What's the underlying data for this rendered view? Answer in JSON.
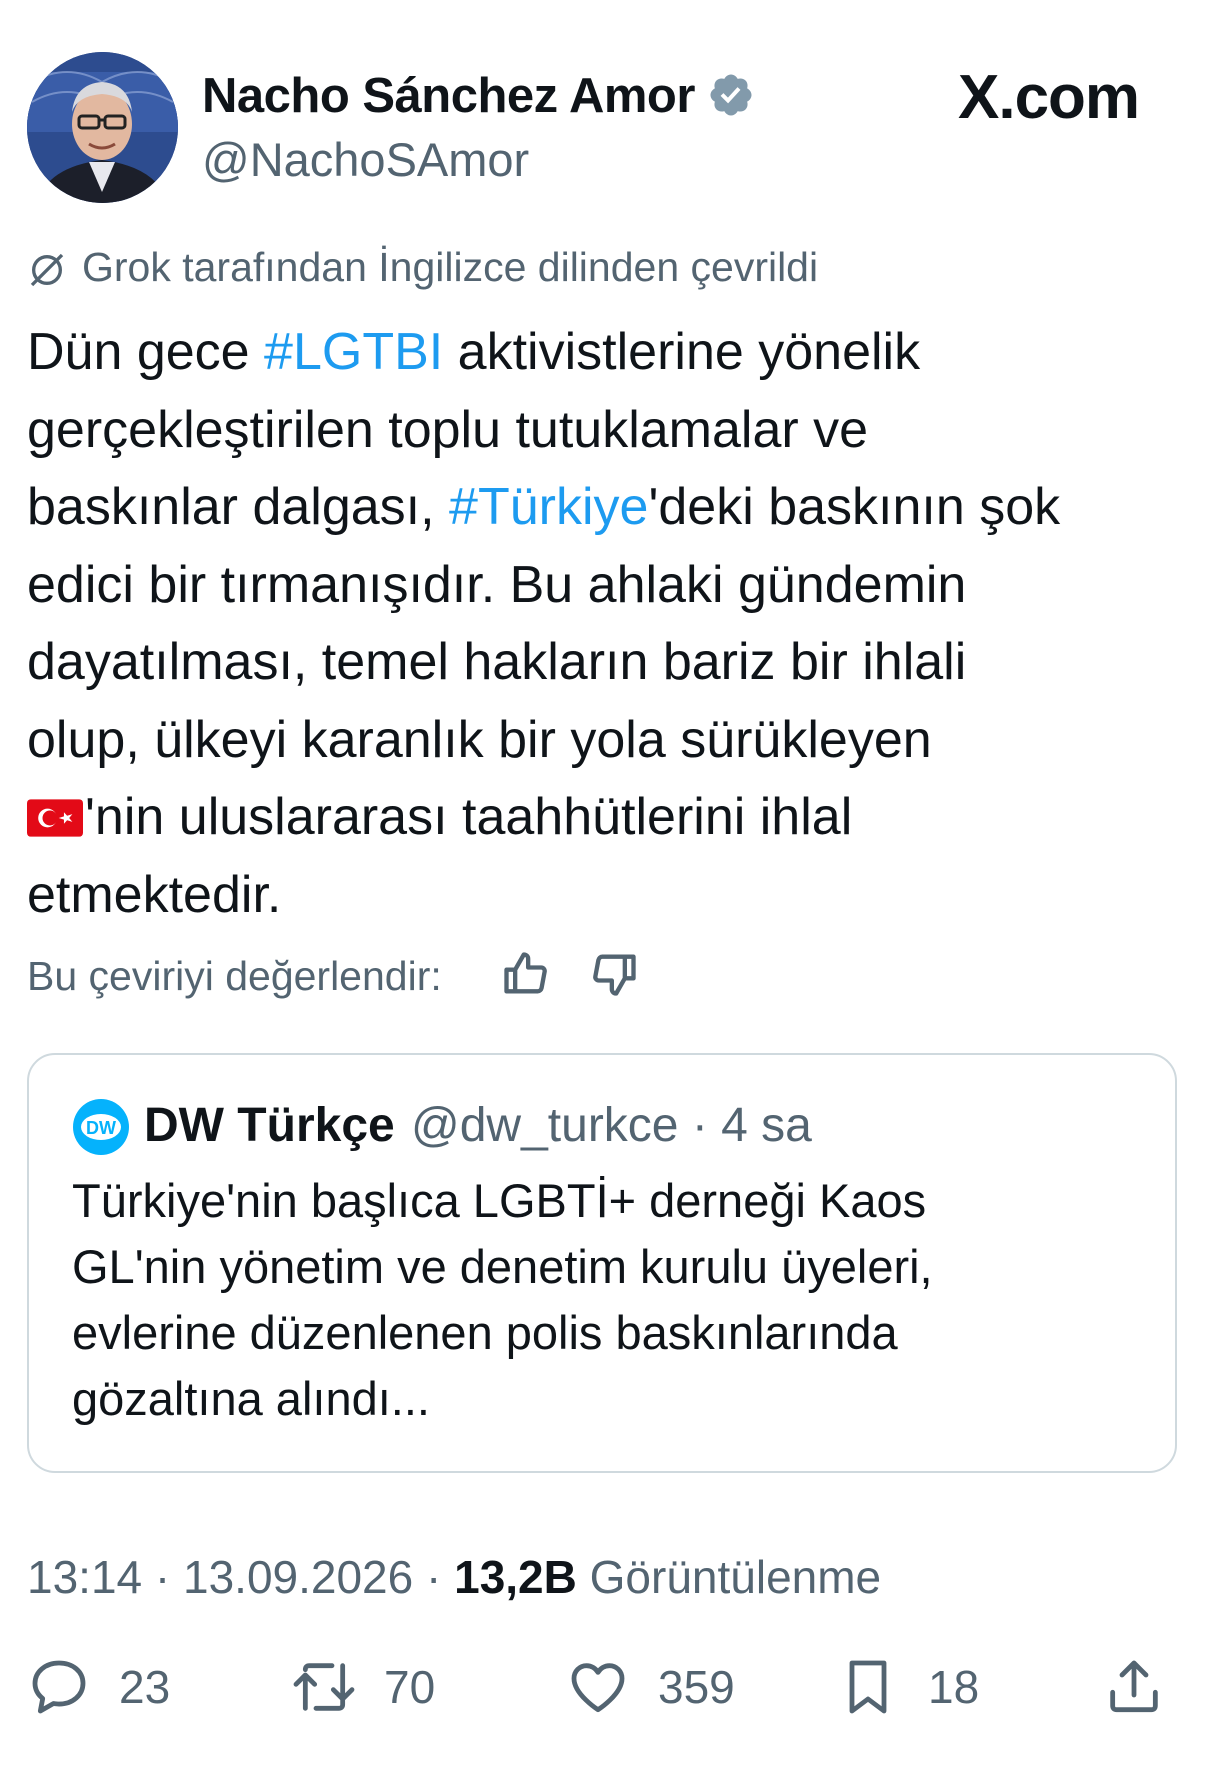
{
  "site": {
    "logo_text": "X.com"
  },
  "author": {
    "name": "Nacho Sánchez Amor",
    "handle": "@NachoSAmor",
    "verified_icon": "verified-badge-icon",
    "verified_color": "#829aab"
  },
  "translation": {
    "note": "Grok tarafından İngilizce dilinden çevrildi",
    "icon": "translate-icon",
    "rate_label": "Bu çeviriyi değerlendir:"
  },
  "tweet": {
    "lines": [
      {
        "pre": "Dün gece ",
        "tag": "#LGTBI",
        "post": " aktivistlerine yönelik"
      },
      {
        "text": "gerçekleştirilen toplu tutuklamalar ve"
      },
      {
        "pre": "baskınlar dalgası, ",
        "tag": "#Türkiye",
        "post": "'deki baskının şok"
      },
      {
        "text": "edici bir tırmanışıdır. Bu ahlaki gündemin"
      },
      {
        "text": "dayatılması, temel hakların bariz bir ihlali"
      },
      {
        "text": "olup, ülkeyi karanlık bir yola sürükleyen"
      },
      {
        "flag_icon": "turkey-flag-icon",
        "text": "'nin uluslararası taahhütlerini ihlal"
      },
      {
        "text": "etmektedir."
      }
    ],
    "hashtag_color": "#1d9bf0"
  },
  "quote": {
    "name": "DW Türkçe",
    "handle_time": "@dw_turkce · 4 sa",
    "logo_text": "DW",
    "lines": [
      "Türkiye'nin başlıca LGBTİ+ derneği Kaos",
      "GL'nin yönetim ve denetim kurulu üyeleri,",
      "evlerine düzenlenen polis baskınlarında",
      "gözaltına alındı..."
    ]
  },
  "meta": {
    "time_date": "13:14 · 13.09.2026 · ",
    "views_count": "13,2B",
    "views_label": " Görüntülenme"
  },
  "actions": {
    "replies": "23",
    "retweets": "70",
    "likes": "359",
    "bookmarks": "18"
  },
  "colors": {
    "text": "#0f1419",
    "secondary": "#536471",
    "border": "#cfd9de",
    "accent": "#1d9bf0"
  }
}
